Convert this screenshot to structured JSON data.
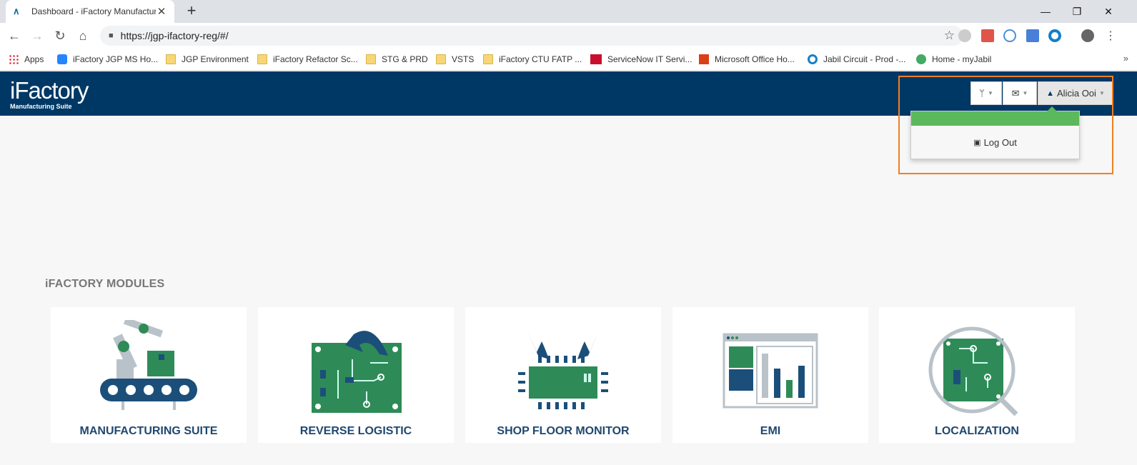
{
  "browser": {
    "tab_title": "Dashboard - iFactory Manufactur",
    "url": "https://jgp-ifactory-reg/#/"
  },
  "bookmarks": [
    {
      "label": "Apps",
      "icon": "apps-grid-icon"
    },
    {
      "label": "iFactory JGP MS Ho...",
      "icon": "confluence-icon"
    },
    {
      "label": "JGP Environment",
      "icon": "folder-icon"
    },
    {
      "label": "iFactory Refactor Sc...",
      "icon": "folder-icon"
    },
    {
      "label": "STG & PRD",
      "icon": "folder-icon"
    },
    {
      "label": "VSTS",
      "icon": "folder-icon"
    },
    {
      "label": "iFactory CTU FATP ...",
      "icon": "folder-icon"
    },
    {
      "label": "ServiceNow IT Servi...",
      "icon": "servicenow-icon"
    },
    {
      "label": "Microsoft Office Ho...",
      "icon": "office-icon"
    },
    {
      "label": "Jabil Circuit - Prod -...",
      "icon": "jabil-icon"
    },
    {
      "label": "Home - myJabil",
      "icon": "globe-icon"
    }
  ],
  "header": {
    "logo_text": "iFactory",
    "logo_subtext": "Manufacturing Suite",
    "user_name": "Alicia Ooi",
    "user_menu": {
      "logout_label": "Log Out"
    }
  },
  "modules": {
    "title": "iFACTORY MODULES",
    "items": [
      {
        "label": "MANUFACTURING SUITE"
      },
      {
        "label": "REVERSE LOGISTIC"
      },
      {
        "label": "SHOP FLOOR MONITOR"
      },
      {
        "label": "EMI"
      },
      {
        "label": "LOCALIZATION"
      }
    ]
  },
  "colors": {
    "header_bg": "#003865",
    "accent_green": "#5cb85c",
    "highlight": "#f07f22",
    "module_label": "#21486e"
  }
}
